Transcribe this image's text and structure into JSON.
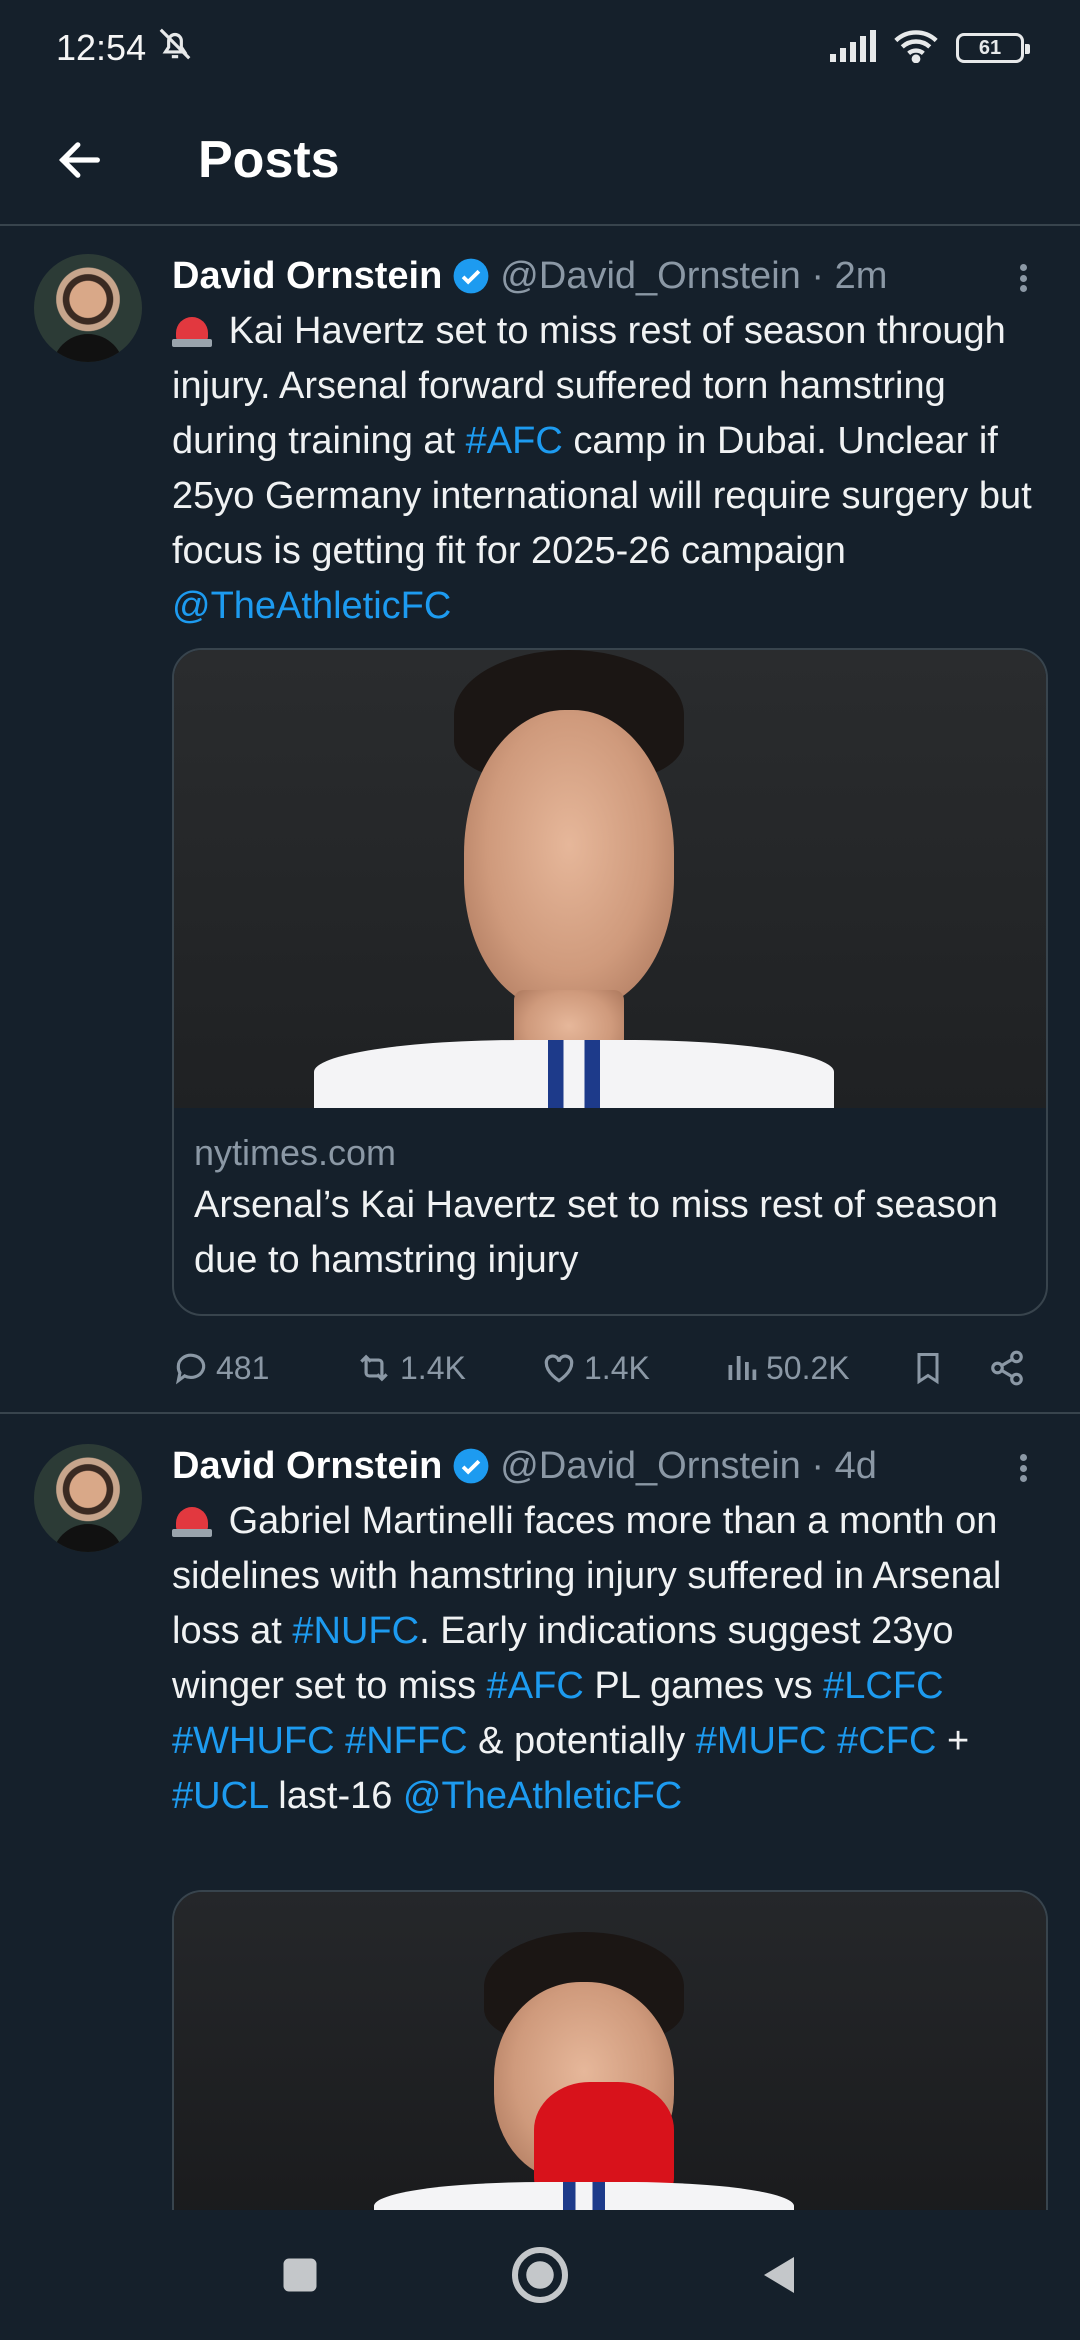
{
  "status_bar": {
    "time": "12:54",
    "battery": "61"
  },
  "header": {
    "title": "Posts"
  },
  "posts": [
    {
      "author": "David Ornstein",
      "handle": "@David_Ornstein",
      "time": "2m",
      "text_parts": {
        "t1": "Kai Havertz set to miss rest of season through injury. Arsenal forward suffered torn hamstring during training at ",
        "link1": "#AFC",
        "t2": " camp in Dubai. Unclear if 25yo Germany international will require surgery but focus is getting fit for 2025-26 campaign ",
        "link2": "@TheAthleticFC"
      },
      "card": {
        "domain": "nytimes.com",
        "title": "Arsenal’s Kai Havertz set to miss rest of season due to hamstring injury"
      },
      "stats": {
        "replies": "481",
        "reposts": "1.4K",
        "likes": "1.4K",
        "views": "50.2K"
      }
    },
    {
      "author": "David Ornstein",
      "handle": "@David_Ornstein",
      "time": "4d",
      "text_parts": {
        "t1": "Gabriel Martinelli faces more than a month on sidelines with hamstring injury suffered in Arsenal loss at ",
        "l1": "#NUFC",
        "t2": ". Early indications suggest 23yo winger set to miss ",
        "l2": "#AFC",
        "t3": " PL games vs ",
        "l3": "#LCFC",
        "l4": "#WHUFC",
        "l5": "#NFFC",
        "t4": " & potentially ",
        "l6": "#MUFC",
        "l7": "#CFC",
        "t5": " + ",
        "l8": "#UCL",
        "t6": " last-16 ",
        "l9": "@TheAthleticFC"
      }
    }
  ],
  "colors": {
    "background": "#15202b",
    "link": "#1d9bf0",
    "muted": "#8b98a5",
    "divider": "#38444d"
  }
}
